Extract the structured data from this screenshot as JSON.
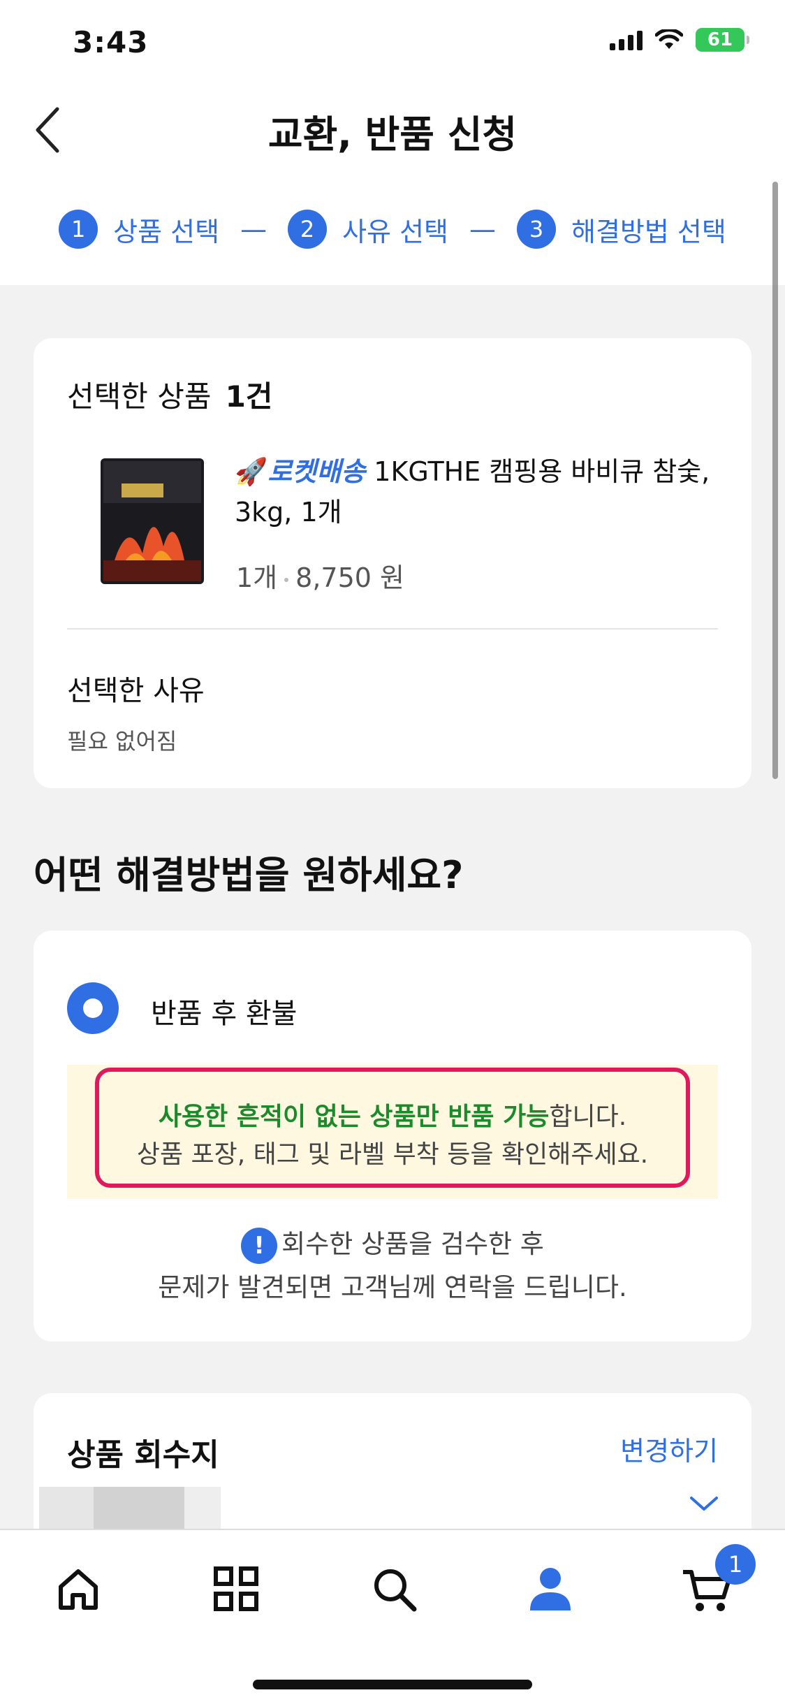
{
  "status_bar": {
    "time": "3:43",
    "battery": "61"
  },
  "header": {
    "title": "교환, 반품 신청"
  },
  "steps": [
    {
      "num": "1",
      "label": "상품 선택"
    },
    {
      "num": "2",
      "label": "사유 선택"
    },
    {
      "num": "3",
      "label": "해결방법 선택"
    }
  ],
  "step_separator": "—",
  "selected": {
    "title": "선택한 상품",
    "count": "1건",
    "rocket_label": "로켓배송",
    "product_name": "1KGTHE 캠핑용 바비큐 참숯, 3kg, 1개",
    "quantity": "1개",
    "price": "8,750 원",
    "reason_label": "선택한 사유",
    "reason_value": "필요 없어짐"
  },
  "question": "어떤 해결방법을 원하세요?",
  "option": {
    "label": "반품 후 환불",
    "notice_highlight": "사용한 흔적이 없는 상품만 반품 가능",
    "notice_rest": "합니다.",
    "notice_line2": "상품 포장, 태그 및 라벨 부착 등을 확인해주세요.",
    "info_icon": "!",
    "info_line1": "회수한 상품을 검수한 후",
    "info_line2": "문제가 발견되면 고객님께 연락을 드립니다."
  },
  "pickup": {
    "title": "상품 회수지",
    "change_label": "변경하기"
  },
  "tabbar": {
    "items": [
      "home-icon",
      "categories-icon",
      "search-icon",
      "my-account-icon",
      "cart-icon"
    ],
    "cart_badge": "1",
    "active": "my-account-icon",
    "active_color": "#2f6fe3"
  },
  "colors": {
    "accent": "#2f6fe3",
    "notice_border": "#e0195d",
    "notice_bg": "#fef8e1",
    "notice_green": "#1a8a2a"
  }
}
